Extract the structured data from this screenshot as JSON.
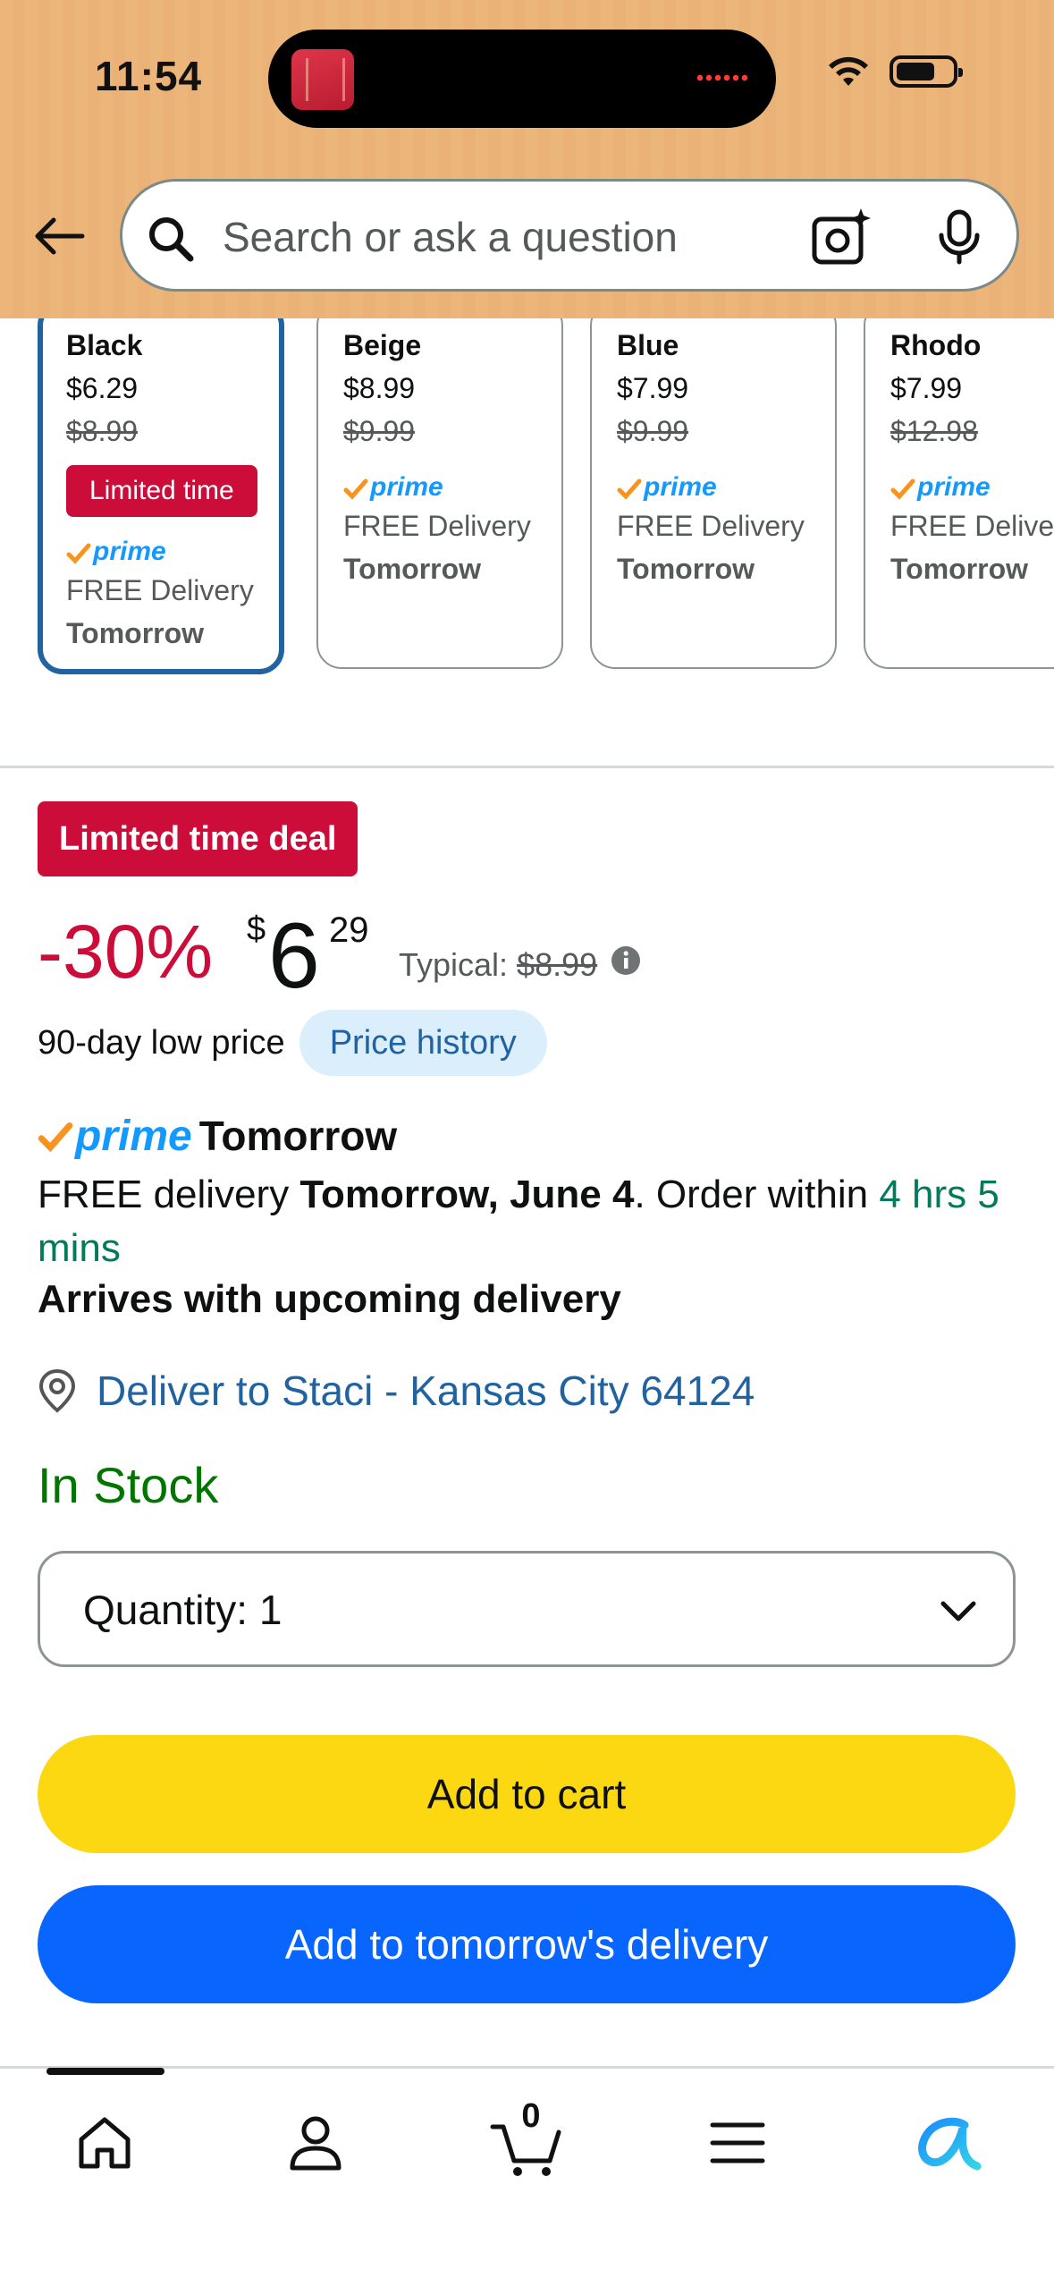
{
  "status_bar": {
    "time": "11:54"
  },
  "search": {
    "placeholder": "Search or ask a question"
  },
  "variants": [
    {
      "name": "Black",
      "price": "$6.29",
      "list_price": "$8.99",
      "badge": "Limited time",
      "prime": "prime",
      "delivery": "FREE Delivery",
      "when": "Tomorrow",
      "selected": true
    },
    {
      "name": "Beige",
      "price": "$8.99",
      "list_price": "$9.99",
      "prime": "prime",
      "delivery": "FREE Delivery",
      "when": "Tomorrow"
    },
    {
      "name": "Blue",
      "price": "$7.99",
      "list_price": "$9.99",
      "prime": "prime",
      "delivery": "FREE Delivery",
      "when": "Tomorrow"
    },
    {
      "name": "Rhodo",
      "price": "$7.99",
      "list_price": "$12.98",
      "prime": "prime",
      "delivery": "FREE Delivery",
      "when": "Tomorrow"
    }
  ],
  "deal": {
    "badge": "Limited time deal",
    "discount": "-30%",
    "currency": "$",
    "price_whole": "6",
    "price_fraction": "29",
    "typical_label": "Typical:",
    "typical_price": "$8.99",
    "low_price_text": "90-day low price",
    "price_history": "Price history"
  },
  "delivery": {
    "prime_label": "prime",
    "prime_tomorrow": "Tomorrow",
    "free_delivery": "FREE delivery",
    "date": "Tomorrow, June 4",
    "order_within": ". Order within",
    "countdown": "4 hrs 5 mins",
    "arrives": "Arrives with upcoming delivery",
    "deliver_to": "Deliver to Staci - Kansas City 64124"
  },
  "stock": "In Stock",
  "quantity": {
    "label": "Quantity:",
    "value": "1"
  },
  "buttons": {
    "add_to_cart": "Add to cart",
    "add_to_tomorrow": "Add to tomorrow's delivery"
  },
  "nav": {
    "cart_count": "0"
  },
  "colors": {
    "header_bg": "#ecb57a",
    "deal_red": "#cc0c39",
    "cart_yellow": "#fbd812",
    "buy_blue": "#0866ff",
    "link_blue": "#2162a1",
    "stock_green": "#007600",
    "prime_blue": "#1399ff"
  }
}
